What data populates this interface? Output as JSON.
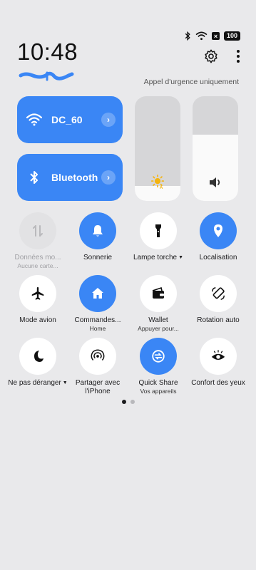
{
  "status_bar": {
    "battery": "100",
    "icons": [
      "bluetooth-icon",
      "wifi-icon",
      "dnd-x-icon",
      "battery-icon"
    ]
  },
  "header": {
    "time": "10:48",
    "emergency_text": "Appel d'urgence uniquement",
    "icons": [
      "settings-icon",
      "more-vertical-icon"
    ]
  },
  "wide_tiles": [
    {
      "label": "DC_60",
      "icon": "wifi-icon",
      "active": true
    },
    {
      "label": "Bluetooth",
      "icon": "bluetooth-icon",
      "active": true
    }
  ],
  "sliders": [
    {
      "name": "brightness",
      "icon": "sun-auto-icon",
      "level": 0.14
    },
    {
      "name": "volume",
      "icon": "speaker-icon",
      "level": 0.63
    }
  ],
  "quick_settings": [
    {
      "label": "Données mo...",
      "sub": "Aucune carte...",
      "icon": "mobile-data-icon",
      "state": "disabled"
    },
    {
      "label": "Sonnerie",
      "sub": "",
      "icon": "bell-icon",
      "state": "on"
    },
    {
      "label": "Lampe torche",
      "sub": "",
      "icon": "flashlight-icon",
      "state": "off",
      "dropdown": true
    },
    {
      "label": "Localisation",
      "sub": "",
      "icon": "location-pin-icon",
      "state": "on"
    },
    {
      "label": "Mode avion",
      "sub": "",
      "icon": "airplane-icon",
      "state": "off"
    },
    {
      "label": "Commandes...",
      "sub": "Home",
      "icon": "home-icon",
      "state": "on"
    },
    {
      "label": "Wallet",
      "sub": "Appuyer pour...",
      "icon": "wallet-icon",
      "state": "off"
    },
    {
      "label": "Rotation auto",
      "sub": "",
      "icon": "rotate-icon",
      "state": "off"
    },
    {
      "label": "Ne pas déranger",
      "sub": "",
      "icon": "moon-icon",
      "state": "off",
      "dropdown": true
    },
    {
      "label": "Partager avec l'iPhone",
      "sub": "",
      "icon": "share-signal-icon",
      "state": "off"
    },
    {
      "label": "Quick Share",
      "sub": "Vos appareils",
      "icon": "quick-share-icon",
      "state": "on"
    },
    {
      "label": "Confort des yeux",
      "sub": "",
      "icon": "eye-icon",
      "state": "off"
    }
  ],
  "pager": {
    "pages": 2,
    "current": 1
  },
  "colors": {
    "accent": "#3a86f5",
    "background": "#e9e9eb",
    "tile_off": "#ffffff"
  }
}
